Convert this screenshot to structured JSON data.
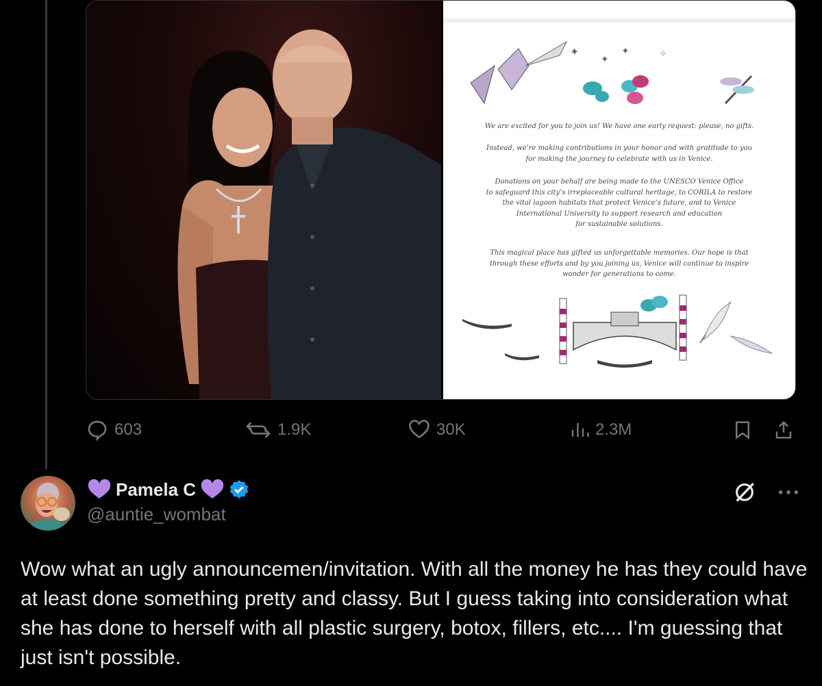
{
  "media": {
    "invitation_lines": [
      "We are excited for you to join us! We have one early request: please, no gifts.",
      "Instead, we’re making contributions in your honor and with gratitude to you\nfor making the journey to celebrate with us in Venice.",
      "Donations on your behalf are being made to the UNESCO Venice Office\nto safeguard this city’s irreplaceable cultural heritage, to CORILA to restore\nthe vital lagoon habitats that protect Venice’s future, and to Venice\nInternational University to support research and education\nfor sustainable solutions.",
      "This magical place has gifted us unforgettable memories. Our hope is that\nthrough these efforts and by you joining us, Venice will continue to inspire\nwonder for generations to come."
    ]
  },
  "actions": {
    "replies": "603",
    "reposts": "1.9K",
    "likes": "30K",
    "views": "2.3M"
  },
  "reply": {
    "name": "Pamela C",
    "handle": "@auntie_wombat",
    "text": "Wow what an ugly announcemen/invitation. With all the money he has they could have at least done something pretty and classy. But I guess taking into consideration what she has done to herself with all plastic surgery, botox, fillers, etc.... I'm guessing that just isn't possible."
  },
  "icons": [
    "speech-bubble-icon",
    "repost-icon",
    "heart-icon",
    "views-bar-icon",
    "bookmark-icon",
    "share-icon",
    "verified-badge-icon",
    "purple-heart-icon",
    "grok-icon",
    "more-icon"
  ],
  "colors": {
    "background": "#000000",
    "text": "#e7e9ea",
    "muted": "#71767b",
    "verified": "#1d9bf0",
    "heart_emoji": "#b388e8"
  }
}
